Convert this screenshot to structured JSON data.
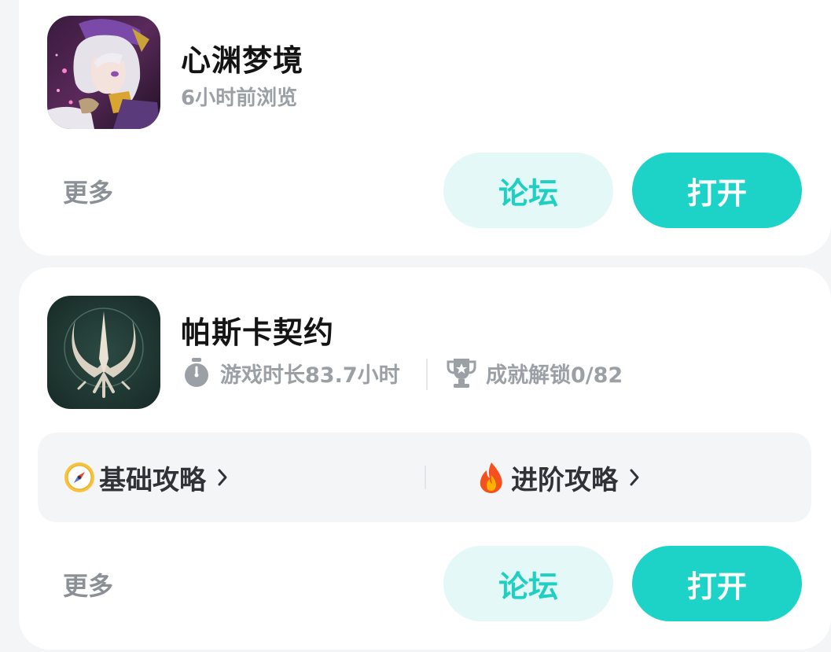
{
  "cards": [
    {
      "title": "心渊梦境",
      "subtitle": "6小时前浏览",
      "more_label": "更多",
      "forum_label": "论坛",
      "open_label": "打开"
    },
    {
      "title": "帕斯卡契约",
      "playtime": "游戏时长83.7小时",
      "achievements": "成就解锁0/82",
      "guide_basic": "基础攻略",
      "guide_advanced": "进阶攻略",
      "more_label": "更多",
      "forum_label": "论坛",
      "open_label": "打开"
    }
  ],
  "colors": {
    "accent": "#1dd3c7",
    "forum_bg": "#e3f8f7",
    "forum_text": "#1fcfc2",
    "muted_text": "#9aa0a6",
    "background": "#f3f5f7"
  },
  "icons": [
    "app-icon-xinyuan-mengjing",
    "app-icon-pascal-contract",
    "stopwatch-icon",
    "trophy-icon",
    "compass-icon",
    "fire-icon",
    "chevron-right-icon"
  ]
}
